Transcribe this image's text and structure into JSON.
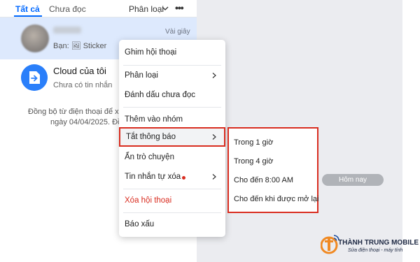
{
  "tabs": {
    "all": "Tất cả",
    "unread": "Chưa đọc",
    "filter": "Phân loại"
  },
  "conversations": [
    {
      "time": "Vài giây",
      "preview": "Bạn: 🖼 Sticker"
    },
    {
      "name": "Cloud của tôi",
      "subtitle": "Chưa có tin nhắn"
    }
  ],
  "sync_notice": {
    "line1": "Đồng bộ từ điện thoại để xe",
    "line2": "ngày 04/04/2025. Đồ"
  },
  "context_menu": {
    "items": [
      {
        "label": "Ghim hội thoại"
      },
      {
        "label": "Phân loại"
      },
      {
        "label": "Đánh dấu chưa đọc"
      },
      {
        "label": "Thêm vào nhóm"
      },
      {
        "label": "Tắt thông báo"
      },
      {
        "label": "Ẩn trò chuyện"
      },
      {
        "label": "Tin nhắn tự xóa"
      },
      {
        "label": "Xóa hội thoại"
      },
      {
        "label": "Báo xấu"
      }
    ]
  },
  "mute_submenu": {
    "items": [
      {
        "label": "Trong 1 giờ"
      },
      {
        "label": "Trong 4 giờ"
      },
      {
        "label": "Cho đến 8:00 AM"
      },
      {
        "label": "Cho đến khi được mở lại"
      }
    ]
  },
  "chat": {
    "date_pill": "Hôm nay"
  },
  "watermark": {
    "title": "THÀNH TRUNG MOBILE",
    "subtitle": "Sửa điện thoại - máy tính"
  },
  "colors": {
    "accent": "#0068ff",
    "highlight_border": "#d92d20",
    "selected_row": "#dde9fd",
    "chat_bg": "#ebecf0"
  },
  "icons": {
    "filter": "chevron-down-icon",
    "more": "more-horizontal-icon",
    "submenu": "chevron-right-icon",
    "cloud": "cloud-share-icon"
  }
}
